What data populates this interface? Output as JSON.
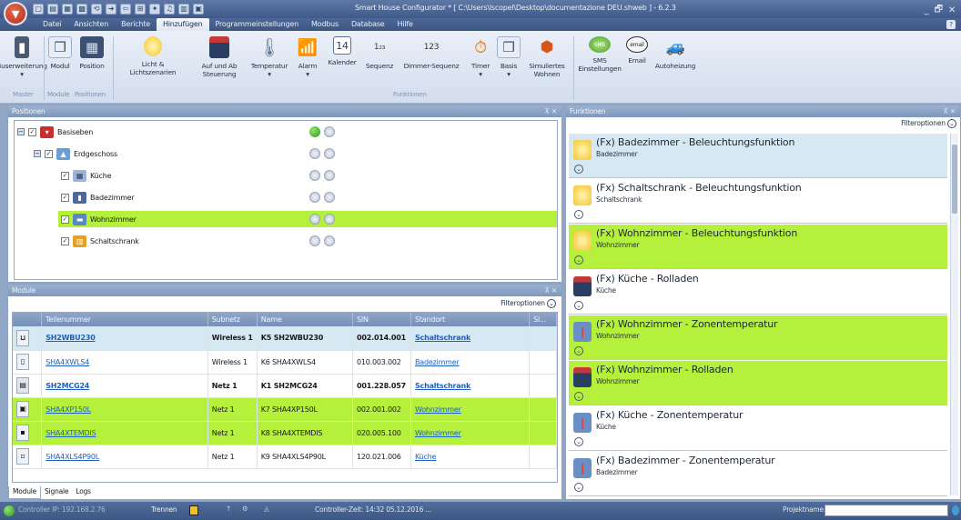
{
  "window": {
    "title": "Smart House Configurator * [ C:\\Users\\lscopel\\Desktop\\documentazione DEU.shweb ] - 6.2.3",
    "min": "_",
    "restore": "🗗",
    "close": "✕"
  },
  "qat": [
    "▢",
    "▤",
    "▦",
    "▩",
    "⟲",
    "➜",
    "⇦",
    "⊞",
    "✦",
    "♫",
    "▥",
    "▣"
  ],
  "menu": {
    "items": [
      "Datei",
      "Ansichten",
      "Berichte",
      "Hinzufügen",
      "Programmeinstellungen",
      "Modbus",
      "Database",
      "Hilfe"
    ],
    "active": "Hinzufügen"
  },
  "ribbon": {
    "buttons": [
      "Buserweiterung",
      "Modul",
      "Position",
      "Licht & Lichtszenarien",
      "Auf und Ab Steuerung",
      "Temperatur",
      "Alarm",
      "Kalender",
      "Sequenz",
      "Dimmer-Sequenz",
      "Timer",
      "Basis",
      "Simuliertes Wohnen",
      "SMS Einstellungen",
      "Email",
      "Autoheizung"
    ],
    "groups": {
      "master": "Master",
      "module": "Module",
      "positionen": "Positionen",
      "funktionen": "Funktionen"
    },
    "kalender_day": "14",
    "sequenz_glyph": "1₂₃",
    "dimmer_glyph": "123",
    "sms_label": "SMS",
    "email_label": "email"
  },
  "positionen": {
    "header": "Positionen",
    "pin": "⊼ ✕",
    "nodes": [
      {
        "label": "Basiseben",
        "led": "green"
      },
      {
        "label": "Erdgeschoss",
        "led": "grey"
      },
      {
        "label": "Küche",
        "led": "grey"
      },
      {
        "label": "Badezimmer",
        "led": "grey"
      },
      {
        "label": "Wohnzimmer",
        "led": "grey"
      },
      {
        "label": "Schaltschrank",
        "led": "grey"
      }
    ]
  },
  "module": {
    "header": "Module",
    "pin": "⊼ ✕",
    "filter": "Filteroptionen",
    "columns": [
      "",
      "Teilenummer",
      "Subnetz",
      "Name",
      "SIN",
      "Standort",
      "Sl..."
    ],
    "rows": [
      {
        "part": "SH2WBU230",
        "subnet": "Wireless 1",
        "name": "K5 SH2WBU230",
        "sin": "002.014.001",
        "location": "Schaltschrank"
      },
      {
        "part": "SHA4XWLS4",
        "subnet": "Wireless 1",
        "name": "K6 SHA4XWLS4",
        "sin": "010.003.002",
        "location": "Badezimmer"
      },
      {
        "part": "SH2MCG24",
        "subnet": "Netz 1",
        "name": "K1 SH2MCG24",
        "sin": "001.228.057",
        "location": "Schaltschrank"
      },
      {
        "part": "SHA4XP150L",
        "subnet": "Netz 1",
        "name": "K7 SHA4XP150L",
        "sin": "002.001.002",
        "location": "Wohnzimmer"
      },
      {
        "part": "SHA4XTEMDIS",
        "subnet": "Netz 1",
        "name": "K8 SHA4XTEMDIS",
        "sin": "020.005.100",
        "location": "Wohnzimmer"
      },
      {
        "part": "SHA4XLS4P90L",
        "subnet": "Netz 1",
        "name": "K9 SHA4XLS4P90L",
        "sin": "120.021.006",
        "location": "Küche"
      }
    ],
    "tabs": [
      "Module",
      "Signale",
      "Logs"
    ]
  },
  "funktionen": {
    "header": "Funktionen",
    "pin": "⊼ ✕",
    "filter": "Filteroptionen",
    "items": [
      {
        "title": "(Fx) Badezimmer - Beleuchtungsfunktion",
        "sub": "Badezimmer",
        "kind": "light"
      },
      {
        "title": "(Fx) Schaltschrank - Beleuchtungsfunktion",
        "sub": "Schaltschrank",
        "kind": "light"
      },
      {
        "title": "(Fx) Wohnzimmer - Beleuchtungsfunktion",
        "sub": "Wohnzimmer",
        "kind": "light"
      },
      {
        "title": "(Fx) Küche - Rolladen",
        "sub": "Küche",
        "kind": "blind"
      },
      {
        "title": "(Fx) Wohnzimmer - Zonentemperatur",
        "sub": "Wohnzimmer",
        "kind": "temp"
      },
      {
        "title": "(Fx) Wohnzimmer - Rolladen",
        "sub": "Wohnzimmer",
        "kind": "blind"
      },
      {
        "title": "(Fx) Küche - Zonentemperatur",
        "sub": "Küche",
        "kind": "temp"
      },
      {
        "title": "(Fx) Badezimmer - Zonentemperatur",
        "sub": "Badezimmer",
        "kind": "temp"
      }
    ]
  },
  "status": {
    "controller_ip": "Controller IP: 192.168.2.76",
    "trennen": "Trennen",
    "time": "Controller-Zeit: 14:32  05.12.2016 ...",
    "projektname": "Projektname:"
  },
  "colors": {
    "selected_green": "#b4f03c",
    "selected_blue": "#d6e9f2",
    "led_green": "#44b82a"
  }
}
